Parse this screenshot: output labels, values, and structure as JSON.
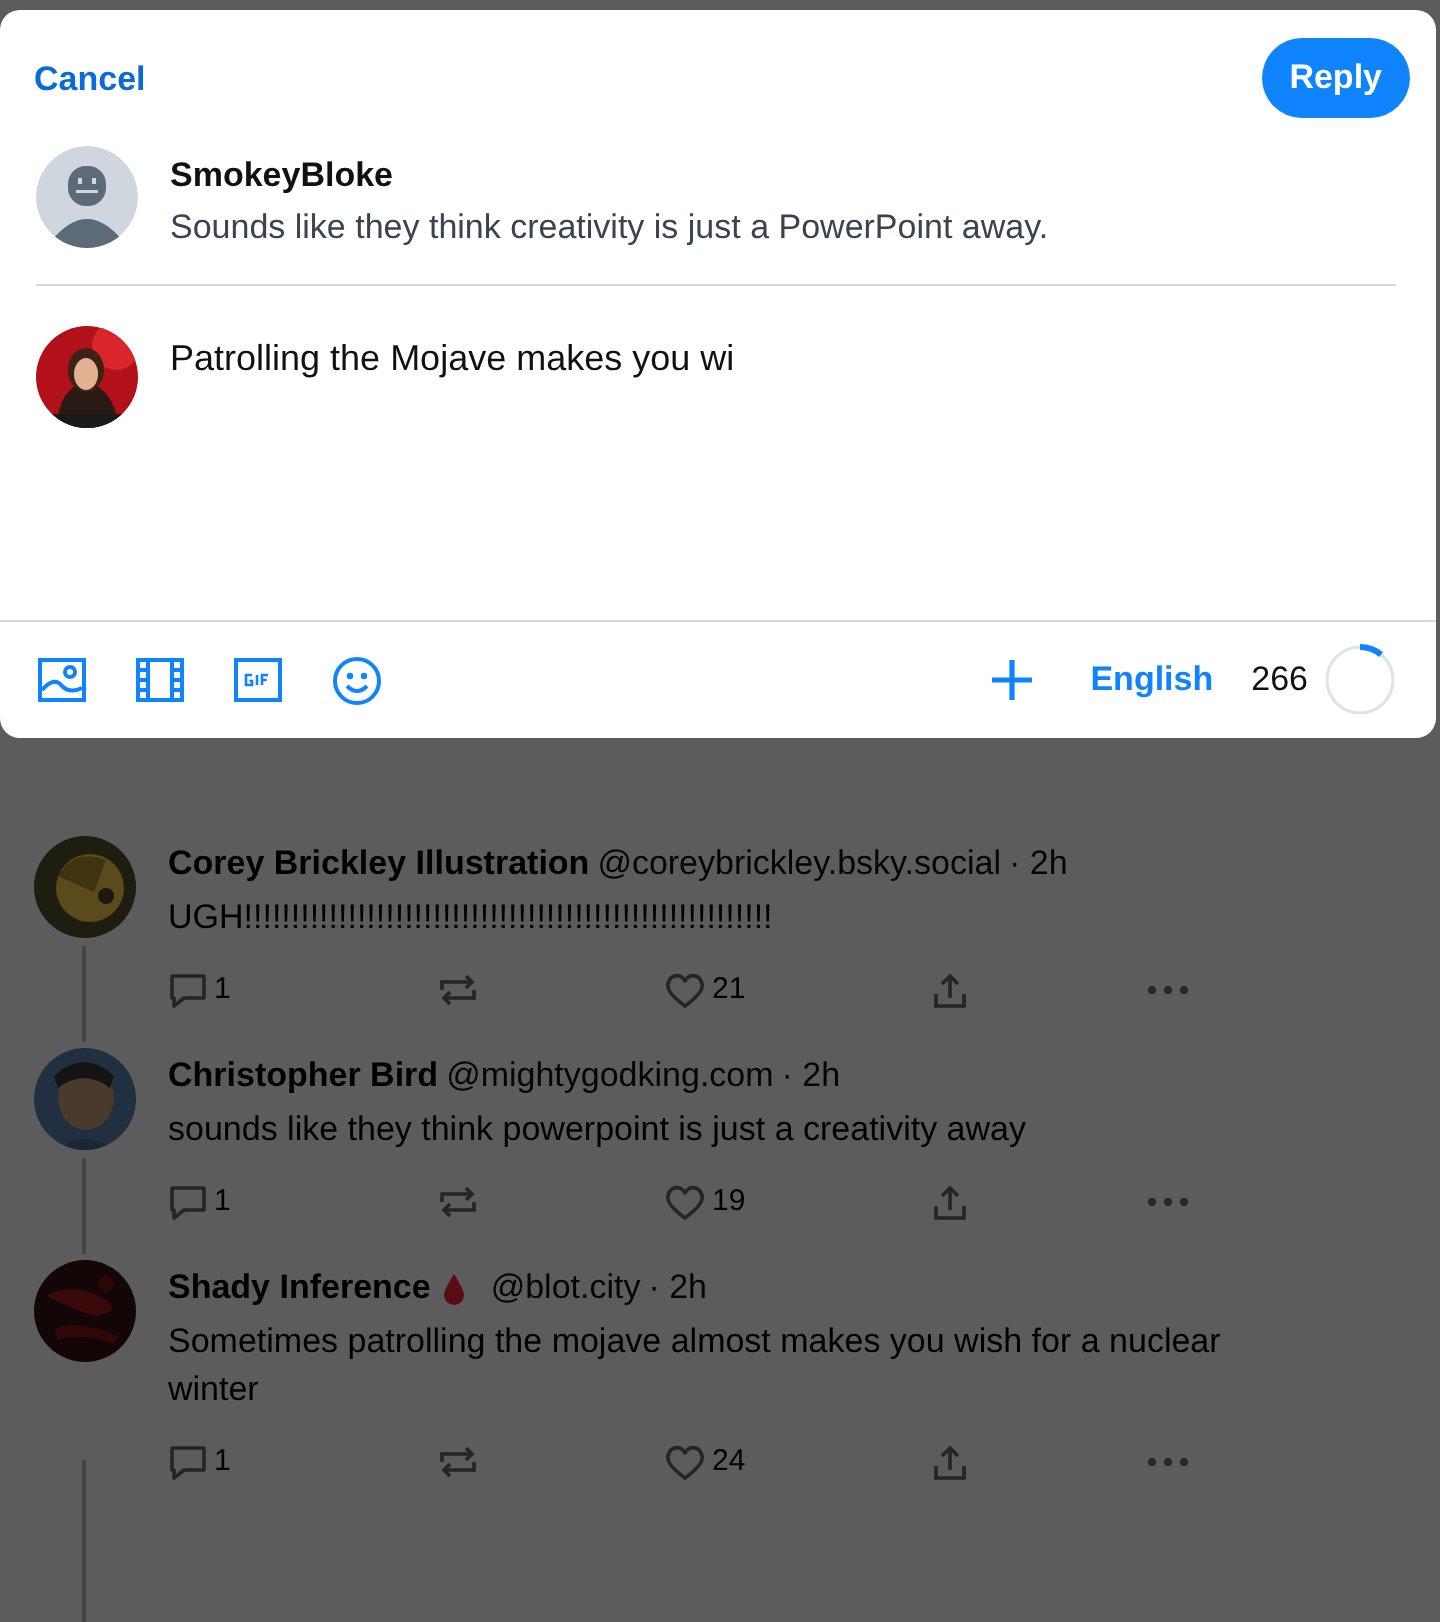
{
  "composer": {
    "cancel": "Cancel",
    "submit": "Reply",
    "parent": {
      "author": "SmokeyBloke",
      "text": "Sounds like they think creativity is just a PowerPoint away."
    },
    "draft": "Patrolling the Mojave makes you wi",
    "language": "English",
    "remaining": "266",
    "level": 0.11
  },
  "feed": [
    {
      "author": "Corey Brickley Illustration",
      "handle": "@coreybrickley.bsky.social",
      "time": "· 2h",
      "text": "UGH!!!!!!!!!!!!!!!!!!!!!!!!!!!!!!!!!!!!!!!!!!!!!!!!!!!!!!!!",
      "replies": "1",
      "likes": "21",
      "badge": false
    },
    {
      "author": "Christopher Bird",
      "handle": "@mightygodking.com",
      "time": "· 2h",
      "text": "sounds like they think powerpoint is just a creativity away",
      "replies": "1",
      "likes": "19",
      "badge": false
    },
    {
      "author": "Shady Inference",
      "handle": "@blot.city",
      "time": "· 2h",
      "text": "Sometimes patrolling the mojave almost makes you wish for a nuclear winter",
      "replies": "1",
      "likes": "24",
      "badge": true
    }
  ]
}
